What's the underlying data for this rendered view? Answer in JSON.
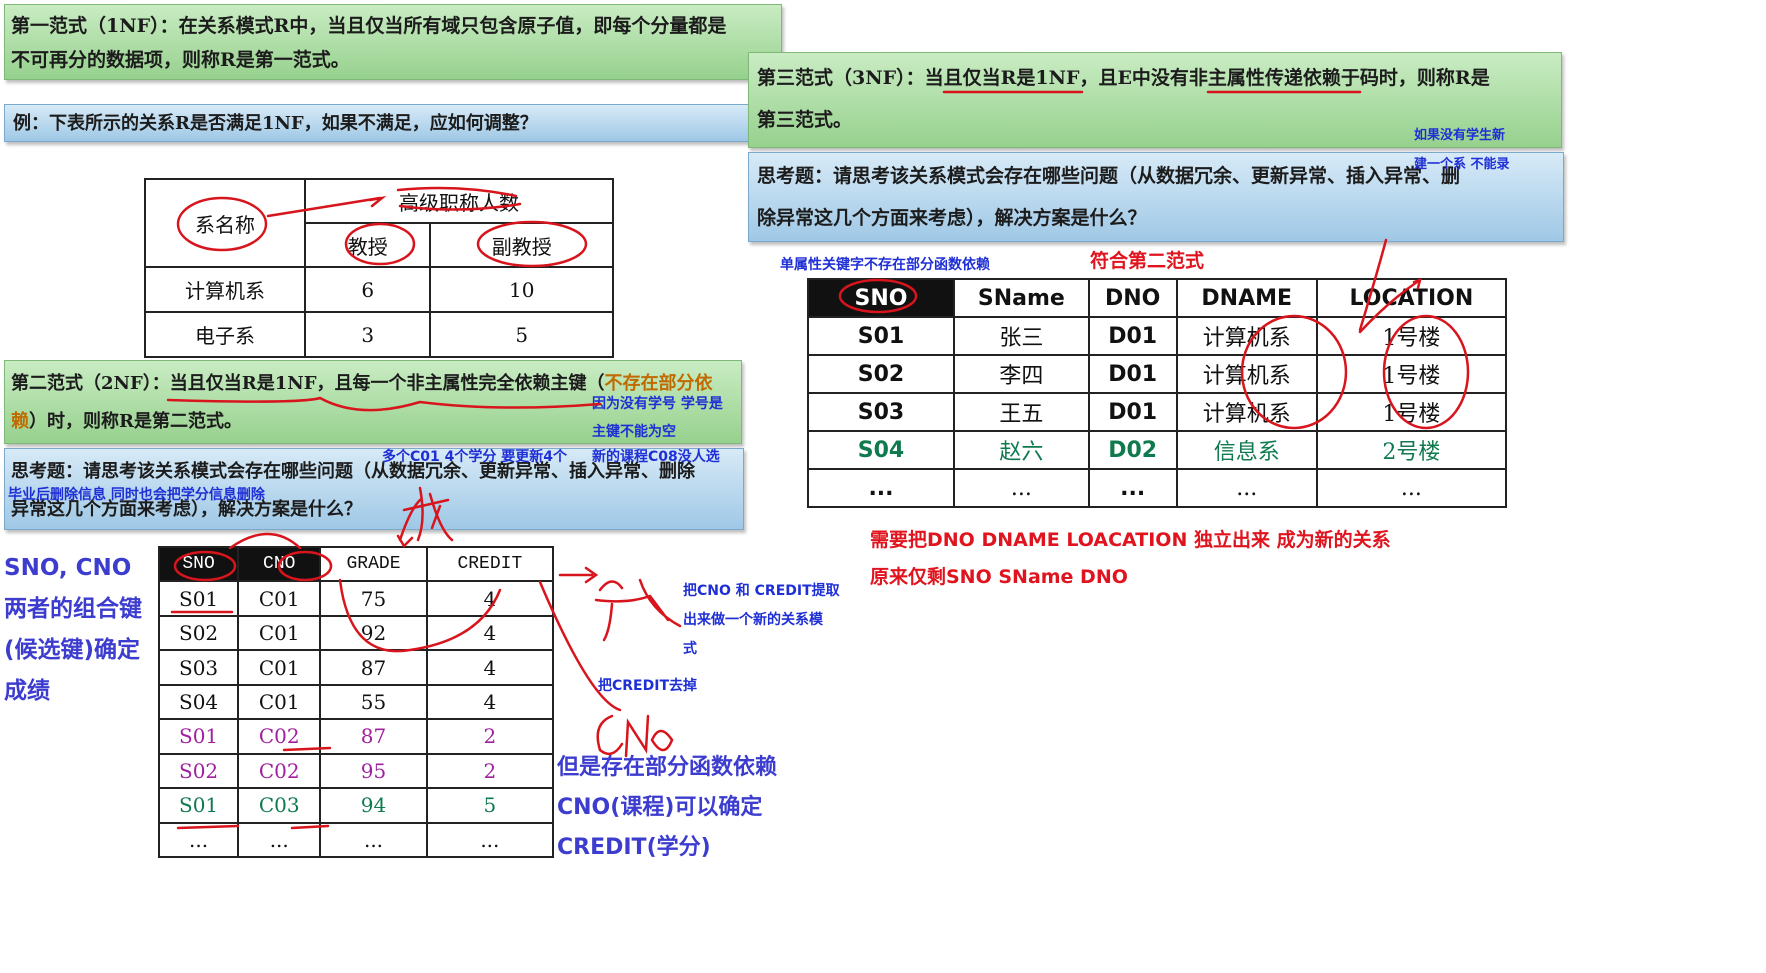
{
  "nf1": {
    "line1": "第一范式（1NF）：在关系模式R中，当且仅当所有域只包含原子值，即每个分量都是",
    "line2": "不可再分的数据项，则称R是第一范式。"
  },
  "example": "例：下表所示的关系R是否满足1NF，如果不满足，应如何调整？",
  "table1": {
    "corner": "系名称",
    "group_header": "高级职称人数",
    "col1": "教授",
    "col2": "副教授",
    "rows": [
      [
        "计算机系",
        "6",
        "10"
      ],
      [
        "电子系",
        "3",
        "5"
      ]
    ]
  },
  "nf2": {
    "line1_a": "第二范式（2NF）：当且仅当R是1NF，且每一个非主属性完全依赖主键（",
    "line1_b": "不存在部分依",
    "line2_a": "赖",
    "line2_b": "）时，则称R是第二范式。"
  },
  "think1": {
    "line1": "思考题：请思考该关系模式会存在哪些问题（从数据冗余、更新异常、插入异常、删除",
    "line2": "异常这几个方面来考虑），解决方案是什么？"
  },
  "table2": {
    "headers": [
      "SNO",
      "CNO",
      "GRADE",
      "CREDIT"
    ],
    "rows": [
      {
        "cells": [
          "S01",
          "C01",
          "75",
          "4"
        ],
        "color": "black"
      },
      {
        "cells": [
          "S02",
          "C01",
          "92",
          "4"
        ],
        "color": "black"
      },
      {
        "cells": [
          "S03",
          "C01",
          "87",
          "4"
        ],
        "color": "black"
      },
      {
        "cells": [
          "S04",
          "C01",
          "55",
          "4"
        ],
        "color": "black"
      },
      {
        "cells": [
          "S01",
          "C02",
          "87",
          "2"
        ],
        "color": "purple"
      },
      {
        "cells": [
          "S02",
          "C02",
          "95",
          "2"
        ],
        "color": "purple"
      },
      {
        "cells": [
          "S01",
          "C03",
          "94",
          "5"
        ],
        "color": "teal"
      },
      {
        "cells": [
          "...",
          "...",
          "...",
          "..."
        ],
        "color": "black"
      }
    ]
  },
  "nf3": {
    "line1": "第三范式（3NF）：当且仅当R是1NF，且E中没有非主属性传递依赖于码时，则称R是",
    "line2": "第三范式。"
  },
  "think2": {
    "line1": "思考题：请思考该关系模式会存在哪些问题（从数据冗余、更新异常、插入异常、删",
    "line2": "除异常这几个方面来考虑），解决方案是什么？"
  },
  "table3": {
    "headers": [
      "SNO",
      "SName",
      "DNO",
      "DNAME",
      "LOCATION"
    ],
    "rows": [
      {
        "cells": [
          "S01",
          "张三",
          "D01",
          "计算机系",
          "1号楼"
        ],
        "color": "black"
      },
      {
        "cells": [
          "S02",
          "李四",
          "D01",
          "计算机系",
          "1号楼"
        ],
        "color": "black"
      },
      {
        "cells": [
          "S03",
          "王五",
          "D01",
          "计算机系",
          "1号楼"
        ],
        "color": "black"
      },
      {
        "cells": [
          "S04",
          "赵六",
          "D02",
          "信息系",
          "2号楼"
        ],
        "color": "teal"
      },
      {
        "cells": [
          "...",
          "...",
          "...",
          "...",
          "..."
        ],
        "color": "black"
      }
    ]
  },
  "notes": {
    "no_student_id": "因为没有学号 学号是",
    "pk_not_null": "主键不能为空",
    "c01_credit": "多个C01 4个学分   要更新4个",
    "new_course": "新的课程C08没人选",
    "graduate_delete": "毕业后删除信息 同时也会把学分信息删除",
    "composite_key": [
      "SNO, CNO",
      "两者的组合键",
      "(候选键)确定",
      "成绩"
    ],
    "extract_cno": [
      "把CNO 和 CREDIT提取",
      "出来做一个新的关系模",
      "式"
    ],
    "remove_credit": "把CREDIT去掉",
    "partial_dep": [
      "但是存在部分函数依赖",
      "CNO(课程)可以确定",
      "CREDIT(学分)"
    ],
    "no_new_student": "如果没有学生新",
    "new_dept": "建一个系 不能录",
    "single_attr": "单属性关键字不存在部分函数依赖",
    "meets_2nf": "符合第二范式",
    "split_dept": "需要把DNO DNAME LOACATION 独立出来 成为新的关系",
    "remain": "原来仅剩SNO SName DNO"
  },
  "colors": {
    "green_box": "#97d18e",
    "blue_box": "#9fc8e6",
    "annotation_red": "#e0141e",
    "annotation_blue": "#1f2fd6",
    "purple_rows": "#a0209e",
    "teal_rows": "#0f7a4e"
  }
}
